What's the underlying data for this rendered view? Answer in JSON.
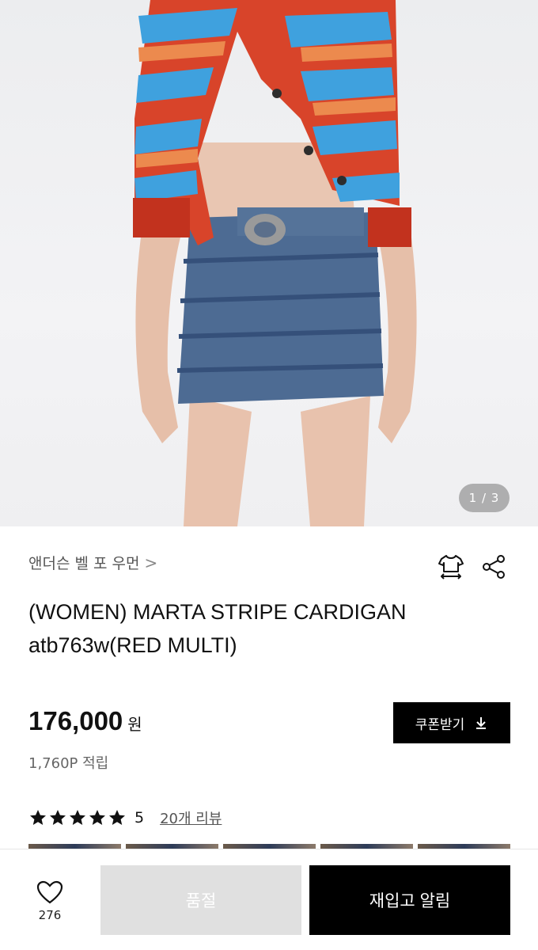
{
  "gallery": {
    "pager": "1 / 3",
    "image_description_icon": "product-photo"
  },
  "product": {
    "brand": "앤더슨 벨 포 우먼",
    "brand_chevron": ">",
    "title": "(WOMEN) MARTA STRIPE CARDIGAN atb763w(RED MULTI)",
    "price": "176,000",
    "currency": "원",
    "points": "1,760P 적립",
    "coupon_label": "쿠폰받기",
    "rating": "5",
    "stars": 5,
    "reviews_link": "20개 리뷰"
  },
  "icons": {
    "size_guide": "tshirt-size-icon",
    "share": "share-icon",
    "download": "download-icon",
    "heart": "heart-icon",
    "star": "star-icon"
  },
  "bottom": {
    "like_count": "276",
    "soldout_label": "품절",
    "restock_label": "재입고 알림"
  },
  "colors": {
    "primary": "#000000",
    "soldout_bg": "#e0e0e0",
    "text_muted": "#666666"
  }
}
